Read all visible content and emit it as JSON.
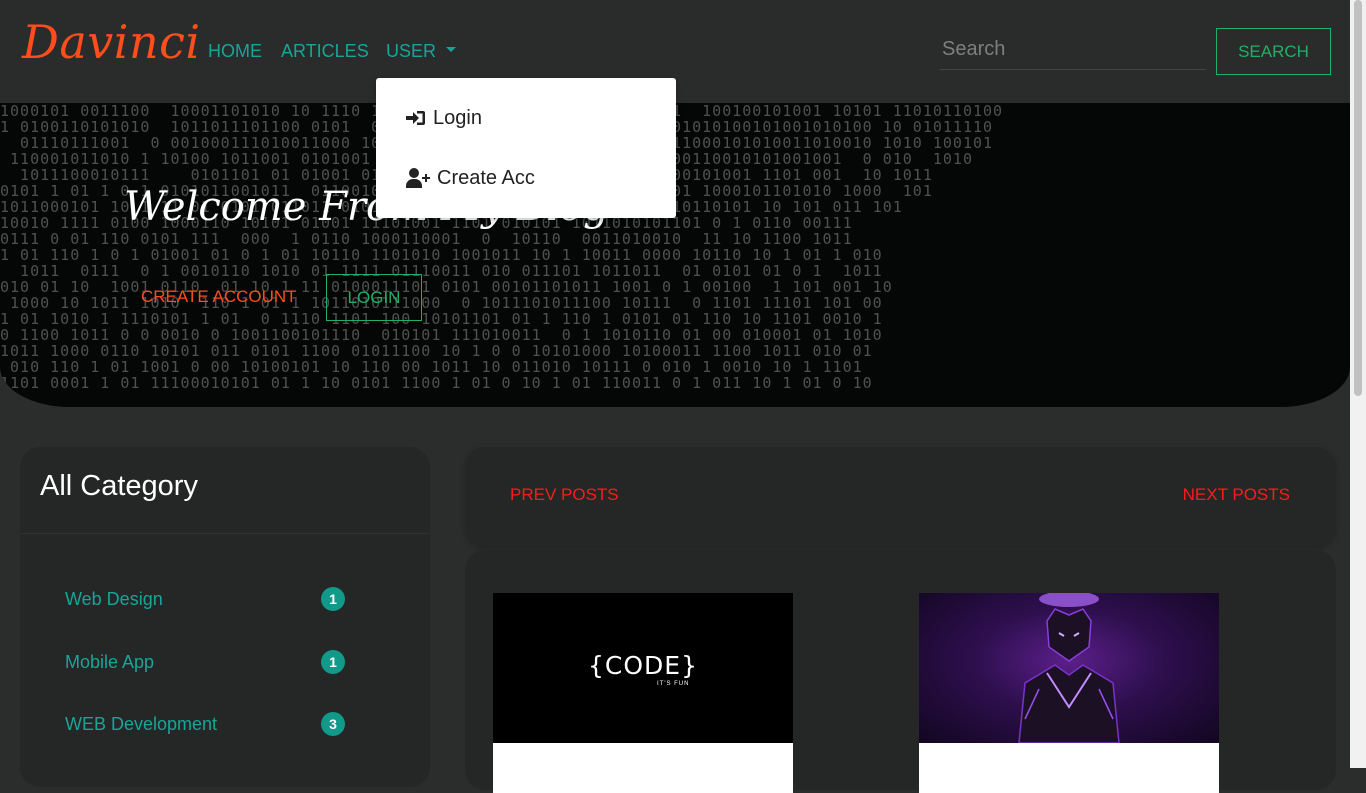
{
  "navbar": {
    "brand": "Davinci",
    "links": {
      "home": "HOME",
      "articles": "ARTICLES",
      "user": "USER"
    },
    "search_placeholder": "Search",
    "search_button": "SEARCH"
  },
  "user_dropdown": {
    "login": "Login",
    "create": "Create Acc"
  },
  "hero": {
    "title": "Welcome From My Blog",
    "create_account": "CREATE ACCOUNT",
    "login": "LOGIN",
    "binary_lines": [
      "1000101 0011100  10001101010 10 1110 101 10000101 100010111010 11011  100100101001 10101 11010110100",
      "1 0100110101010  1011011101100 0101  01 1001010 011 110 010011 101001010100101001010100 10 01011110",
      "  01110111001  0 001000111010011000 10100111100 11  100011001 1101011000101010011010010 1010 100101",
      " 110001011010 1 10100 1011001 0101001  1000110101 1 0 1000010 0110000110010101001001  0 010  1010",
      "  1011100010111    0101101 01 01001 0101 110 10111 111100010011011100101001 1101 001  10 1011",
      "0101 1 01 1 0 1 0101011001011  0110010 01 1 10011100 011110001 100101 1000101101010 1000  101",
      "1011000101 10 1 11 01 0101 011011 01011010 101000 0101  1101011100010110101 10 101 011 101",
      "10010 1111 0100 1000110 10101 01001 11101001 1101 010101 1011010101101 0 1 0110 00111",
      "0111 0 01 110 0101 111  000  1 0110 1000110001  0  10110  0011010010  11 10 1100 1011",
      "1 01 110 1 0 1 01001 01 0 1 01 10110 1101010 1001011 10 1 10011 0000 10110 10 1 01 1 010",
      "  1011  0111  0 1 0010110 1010 01 1111 01110011 010 011101 1011011  01 0101 01 0 1  1011",
      "010 01 10  1001 0110  01 10 1 11 0100011101 0101 00101101011 1001 0 1 00100  1 101 001 10",
      " 1000 10 1011 1010  110 1 01 1 1011010111000  0 1011101011100 10111  0 1101 11101 101 00",
      "1 01 1010 1 1110101 1 01  0 1110 1101 100 10101101 01 1 110 1 0101 01 110 10 1101 0010 1",
      "0 1100 1011 0 0 0010 0 1001100101110  010101 111010011  0 1 1010110 01 00 010001 01 1010",
      "1011 1000 0110 10101 011 0101 1100 01011100 10 1 0 0 10101000 10100011 1100 1011 010 01",
      " 010 110 1 01 1001 0 00 10100101 10 110 00 1011 10 011010 10111 0 010 1 0010 10 1 1101",
      "1101 0001 1 01 11100010101 01 1 10 0101 1100 1 01 0 10 1 01 110011 0 1 011 10 1 01 0 10"
    ]
  },
  "sidebar": {
    "title": "All Category",
    "categories": [
      {
        "label": "Web Design",
        "count": "1"
      },
      {
        "label": "Mobile App",
        "count": "1"
      },
      {
        "label": "WEB Development",
        "count": "3"
      }
    ]
  },
  "pagination": {
    "prev": "PREV POSTS",
    "next": "NEXT POSTS"
  },
  "posts": [
    {
      "image_text": "{CODE}",
      "image_subtext": "IT'S FUN"
    },
    {
      "image_text": ""
    }
  ],
  "colors": {
    "accent_teal": "#18a598",
    "brand_orange": "#ff4d1c",
    "outline_green": "#1fb066",
    "pager_red": "#ff1a1a",
    "badge_teal": "#11998a",
    "background": "#2b2c2c",
    "card": "#252727"
  },
  "icons": {
    "login": "sign-in-icon",
    "create": "user-plus-icon"
  }
}
